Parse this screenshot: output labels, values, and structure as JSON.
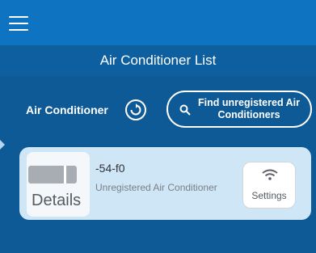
{
  "header": {
    "menu_icon": "menu-icon",
    "title": "Air Conditioner List"
  },
  "toolbar": {
    "label": "Air Conditioner",
    "refresh_icon": "refresh-icon",
    "find_button_label": "Find unregistered Air Conditioners",
    "search_icon": "search-icon"
  },
  "devices": [
    {
      "name": "-54-f0",
      "status": "Unregistered Air Conditioner",
      "details_label": "Details",
      "settings_label": "Settings",
      "wifi_icon": "wifi-icon",
      "device_icon": "air-conditioner-icon"
    }
  ],
  "colors": {
    "top_bar": "#0e73c1",
    "title_bar": "#0d5fa0",
    "background": "#0e5a96",
    "card": "#cfe6f7"
  }
}
